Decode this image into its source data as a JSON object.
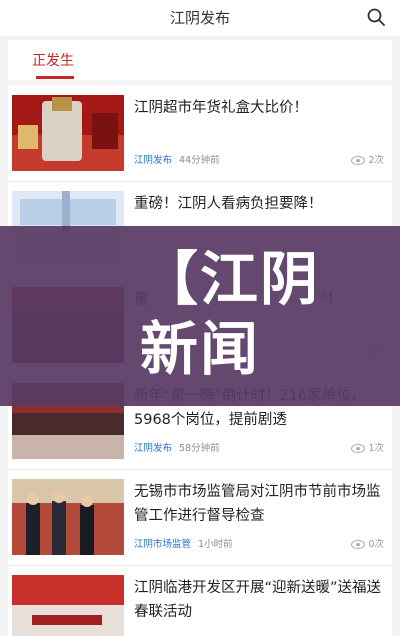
{
  "header": {
    "title": "江阴发布"
  },
  "tabs": [
    {
      "label": "正发生"
    }
  ],
  "articles": [
    {
      "title": "江阴超市年货礼盒大比价！",
      "source": "江阴发布",
      "time": "44分钟前",
      "views": "2次"
    },
    {
      "title": "重磅！江阴人看病负担要降！",
      "source": "",
      "time": "",
      "views": ""
    },
    {
      "title": "重",
      "title_tail": "\"！",
      "source": "",
      "time": "",
      "views": ""
    },
    {
      "title": "新年“第一嗨”倒计时！216家单位，5968个岗位，提前剧透",
      "source": "江阴发布",
      "time": "58分钟前",
      "views": "1次"
    },
    {
      "title": "无锡市市场监管局对江阴市节前市场监管工作进行督导检查",
      "source": "江阴市场监管",
      "time": "1小时前",
      "views": "0次"
    },
    {
      "title": "江阴临港开发区开展“迎新送暖”送福送春联活动",
      "source": "",
      "time": "",
      "views": ""
    }
  ],
  "overlay": {
    "text": "【江阴新闻"
  },
  "colors": {
    "accent": "#c62828",
    "source": "#1e6fc6",
    "overlay": "#583a64"
  }
}
